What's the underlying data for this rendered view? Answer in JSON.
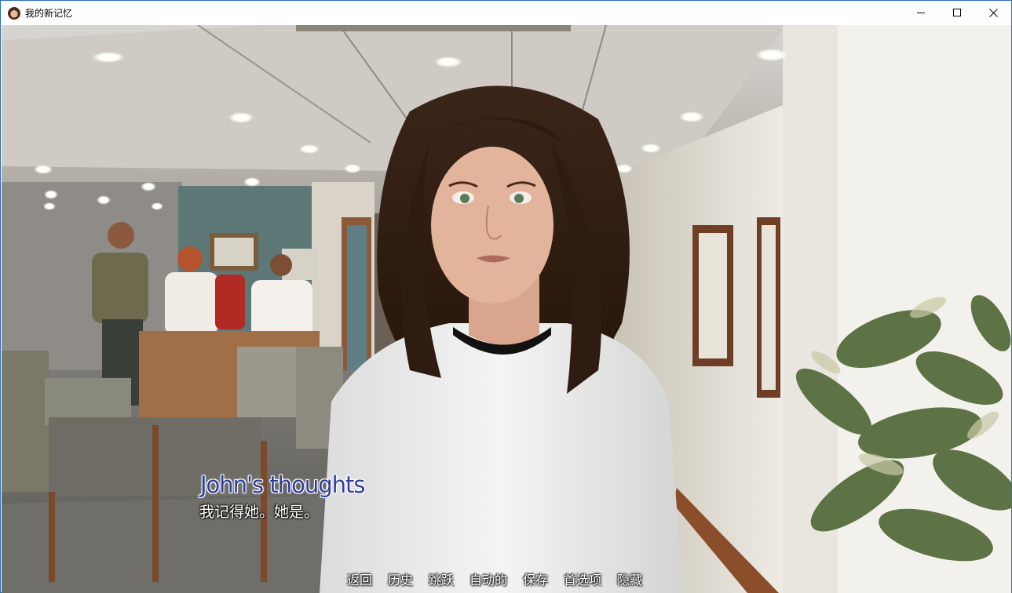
{
  "window": {
    "title": "我的新记忆",
    "icons": [
      "app-icon",
      "minimize-icon",
      "maximize-icon",
      "close-icon"
    ]
  },
  "dialogue": {
    "speaker": "John's thoughts",
    "text": "我记得她。她是。"
  },
  "quick_menu": [
    {
      "label": "返回",
      "name": "quick-menu-back"
    },
    {
      "label": "历史",
      "name": "quick-menu-history"
    },
    {
      "label": "跳跃",
      "name": "quick-menu-skip"
    },
    {
      "label": "自动的",
      "name": "quick-menu-auto"
    },
    {
      "label": "保存",
      "name": "quick-menu-save"
    },
    {
      "label": "首选项",
      "name": "quick-menu-preferences"
    },
    {
      "label": "隐藏",
      "name": "quick-menu-hide"
    }
  ],
  "colors": {
    "speaker_name": "#2f3f9a",
    "window_border": "#2b6fb5"
  }
}
